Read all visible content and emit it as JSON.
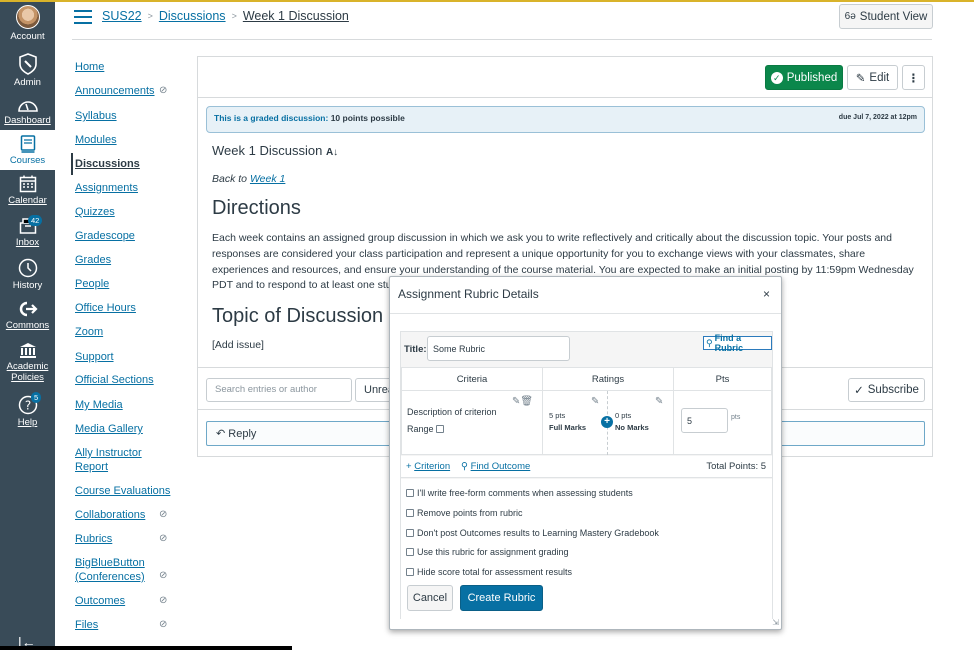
{
  "global_nav": {
    "items": [
      {
        "label": "Account",
        "icon": "avatar"
      },
      {
        "label": "Admin",
        "icon": "shield-wrench-icon"
      },
      {
        "label": "Dashboard",
        "icon": "speedometer-icon"
      },
      {
        "label": "Courses",
        "icon": "book-icon",
        "active": true
      },
      {
        "label": "Calendar",
        "icon": "calendar-icon"
      },
      {
        "label": "Inbox",
        "icon": "inbox-icon",
        "badge": "42"
      },
      {
        "label": "History",
        "icon": "clock-icon"
      },
      {
        "label": "Commons",
        "icon": "commons-icon"
      },
      {
        "label": "Academic Policies",
        "icon": "institution-icon"
      },
      {
        "label": "Help",
        "icon": "question-icon",
        "badge": "5"
      }
    ],
    "collapse_icon": "collapse-nav-icon"
  },
  "header": {
    "breadcrumb": [
      "SUS22",
      "Discussions",
      "Week 1 Discussion"
    ],
    "student_view_label": "Student View"
  },
  "course_nav": {
    "items": [
      {
        "label": "Home"
      },
      {
        "label": "Announcements",
        "hidden": true
      },
      {
        "label": "Syllabus"
      },
      {
        "label": "Modules"
      },
      {
        "label": "Discussions",
        "active": true
      },
      {
        "label": "Assignments"
      },
      {
        "label": "Quizzes"
      },
      {
        "label": "Gradescope"
      },
      {
        "label": "Grades"
      },
      {
        "label": "People"
      },
      {
        "label": "Office Hours"
      },
      {
        "label": "Zoom"
      },
      {
        "label": "Support"
      },
      {
        "label": "Official Sections"
      },
      {
        "label": "My Media"
      },
      {
        "label": "Media Gallery"
      },
      {
        "label": "Ally Instructor Report"
      },
      {
        "label": "Course Evaluations"
      },
      {
        "label": "Collaborations",
        "hidden": true
      },
      {
        "label": "Rubrics",
        "hidden": true
      },
      {
        "label": "BigBlueButton (Conferences)",
        "hidden": true
      },
      {
        "label": "Outcomes",
        "hidden": true
      },
      {
        "label": "Files",
        "hidden": true
      }
    ]
  },
  "discussion": {
    "published_label": "Published",
    "edit_label": "Edit",
    "graded_key": "This is a graded discussion:",
    "graded_value": "10 points possible",
    "due": "due Jul 7, 2022 at 12pm",
    "title": "Week 1 Discussion",
    "back_prefix": "Back to",
    "back_link": "Week 1",
    "directions_heading": "Directions",
    "directions_text": "Each week contains an assigned group discussion in which we ask you to write reflectively and critically about the discussion topic. Your posts and responses are considered your class participation and represent a unique opportunity for you to exchange views with your classmates, share experiences and resources, and ensure your understanding of the course material. You are expected to make an initial posting by 11:59pm Wednesday PDT and to respond to at least one student's posting",
    "topic_heading": "Topic of Discussion",
    "topic_text": "[Add issue]",
    "search_placeholder": "Search entries or author",
    "filter_label": "Unread",
    "subscribe_label": "Subscribe",
    "reply_label": "Reply"
  },
  "modal": {
    "title": "Assignment Rubric Details",
    "close": "×",
    "title_label": "Title:",
    "title_value": "Some Rubric",
    "find_rubric": "Find a Rubric",
    "columns": [
      "Criteria",
      "Ratings",
      "Pts"
    ],
    "criterion": {
      "description": "Description of criterion",
      "range_label": "Range",
      "ratings": [
        {
          "points": "5 pts",
          "description": "Full Marks"
        },
        {
          "points": "0 pts",
          "description": "No Marks"
        }
      ],
      "points": "5",
      "points_unit": "pts"
    },
    "add_criterion": "Criterion",
    "find_outcome": "Find Outcome",
    "total_points": "Total Points: 5",
    "options": [
      "I'll write free-form comments when assessing students",
      "Remove points from rubric",
      "Don't post Outcomes results to Learning Mastery Gradebook",
      "Use this rubric for assignment grading",
      "Hide score total for assessment results"
    ],
    "cancel_label": "Cancel",
    "create_label": "Create Rubric"
  }
}
